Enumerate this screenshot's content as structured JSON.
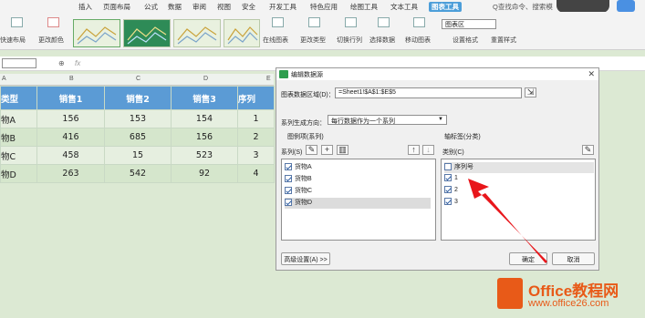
{
  "menu": [
    "插入",
    "页面布局",
    "公式",
    "数据",
    "审阅",
    "视图",
    "安全",
    "开发工具",
    "特色应用",
    "绘图工具",
    "文本工具",
    "图表工具"
  ],
  "search": "Q查找命令、搜索模",
  "ribbon": {
    "quick_layout": "快速布局",
    "change_color": "更改颜色",
    "chart_area": "图表区",
    "online_chart": "在线图表",
    "change_type": "更改类型",
    "switch_rowcol": "切换行列",
    "select_data": "选择数据",
    "move_chart": "移动图表",
    "set_format": "设置格式",
    "reset_style": "重置样式"
  },
  "formula_bar": {
    "fx": "fx"
  },
  "columns": [
    "A",
    "B",
    "C",
    "D",
    "E"
  ],
  "table": {
    "headers": [
      "类型",
      "销售1",
      "销售2",
      "销售3",
      "序列"
    ],
    "rows": [
      [
        "物A",
        "156",
        "153",
        "154",
        "1"
      ],
      [
        "物B",
        "416",
        "685",
        "156",
        "2"
      ],
      [
        "物C",
        "458",
        "15",
        "523",
        "3"
      ],
      [
        "物D",
        "263",
        "542",
        "92",
        "4"
      ]
    ]
  },
  "dialog": {
    "title": "编辑数据源",
    "range_label": "图表数据区域(D)：",
    "range_value": "=Sheet1!$A$1:$E$5",
    "series_dir_label": "系列生成方向：",
    "series_dir_value": "每行数据作为一个系列",
    "legend_label": "图例项(系列)",
    "axis_label": "轴标签(分类)",
    "series_label": "系列(S)",
    "category_label": "类别(C)",
    "series": [
      "货物A",
      "货物B",
      "货物C",
      "货物D"
    ],
    "categories": [
      {
        "label": "序列号",
        "checked": false
      },
      {
        "label": "1",
        "checked": true
      },
      {
        "label": "2",
        "checked": true
      },
      {
        "label": "3",
        "checked": true
      }
    ],
    "advanced": "高级设置(A) >>",
    "ok": "确定",
    "cancel": "取消"
  },
  "watermark": {
    "brand": "Office教程网",
    "url": "www.office26.com"
  },
  "colors": {
    "header": "#5b9bd5",
    "arrow": "#e8161b",
    "brand": "#e85a18"
  }
}
